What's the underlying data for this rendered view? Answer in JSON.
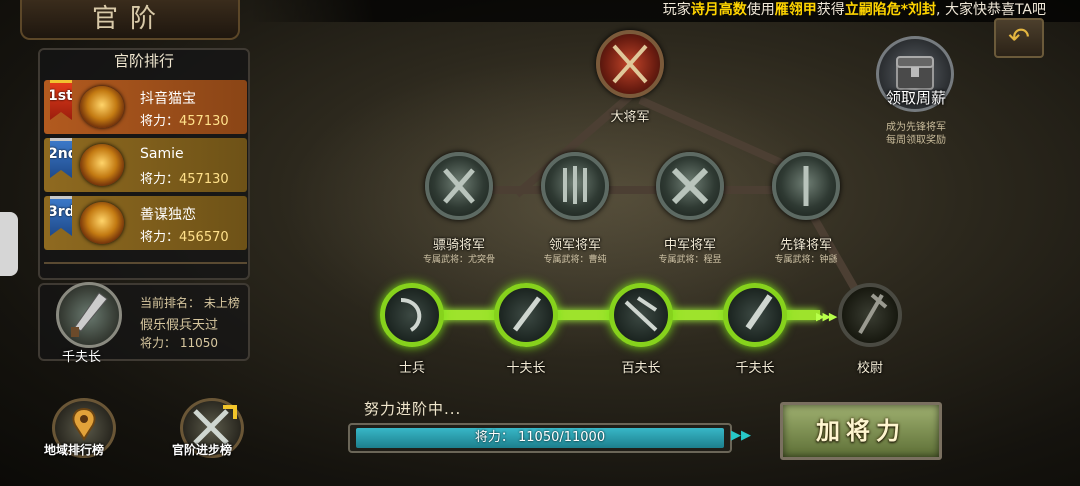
{
  "header": {
    "title": "官阶",
    "ticker_parts": [
      {
        "text": "玩家",
        "highlight": false
      },
      {
        "text": "诗月高数",
        "highlight": true
      },
      {
        "text": "使用",
        "highlight": false
      },
      {
        "text": "雁翎甲",
        "highlight": true
      },
      {
        "text": "获得",
        "highlight": false
      },
      {
        "text": "立嗣陷危*刘封",
        "highlight": true
      },
      {
        "text": ", 大家快恭喜TA吧",
        "highlight": false
      }
    ]
  },
  "ranking": {
    "heading": "官阶排行",
    "power_label": "将力：",
    "entries": [
      {
        "rank": "1st",
        "name": "抖音猫宝",
        "power": "457130"
      },
      {
        "rank": "2nd",
        "name": "Samie",
        "power": "457130"
      },
      {
        "rank": "3rd",
        "name": "善谋独恋",
        "power": "456570"
      }
    ]
  },
  "me": {
    "title": "千夫长",
    "rank_line": "当前排名： 未上榜",
    "name": "假乐假兵天过",
    "power_line": "将力： 11050"
  },
  "bottom_buttons": {
    "regional": "地域排行榜",
    "progress": "官阶进步榜"
  },
  "ranks": {
    "top": {
      "name": "大将军"
    },
    "generals": [
      {
        "name": "骠骑将军",
        "sub": "专属武将：尤突骨"
      },
      {
        "name": "领军将军",
        "sub": "专属武将：曹纯"
      },
      {
        "name": "中军将军",
        "sub": "专属武将：程昱"
      },
      {
        "name": "先锋将军",
        "sub": "专属武将：钟繇"
      }
    ],
    "track": [
      {
        "name": "士兵"
      },
      {
        "name": "十夫长"
      },
      {
        "name": "百夫长"
      },
      {
        "name": "千夫长"
      },
      {
        "name": "校尉"
      }
    ]
  },
  "progress": {
    "title": "努力进阶中...",
    "bar_text": "将力： 11050/11000",
    "value": 11050,
    "max": 11000,
    "button": "加将力"
  },
  "weekly": {
    "label": "领取周薪",
    "note_line1": "成为先锋将军",
    "note_line2": "每周领取奖励"
  },
  "colors": {
    "accent_green": "#9ee32c",
    "progress_cyan": "#38b7c7",
    "highlight_yellow": "#ffd400"
  }
}
